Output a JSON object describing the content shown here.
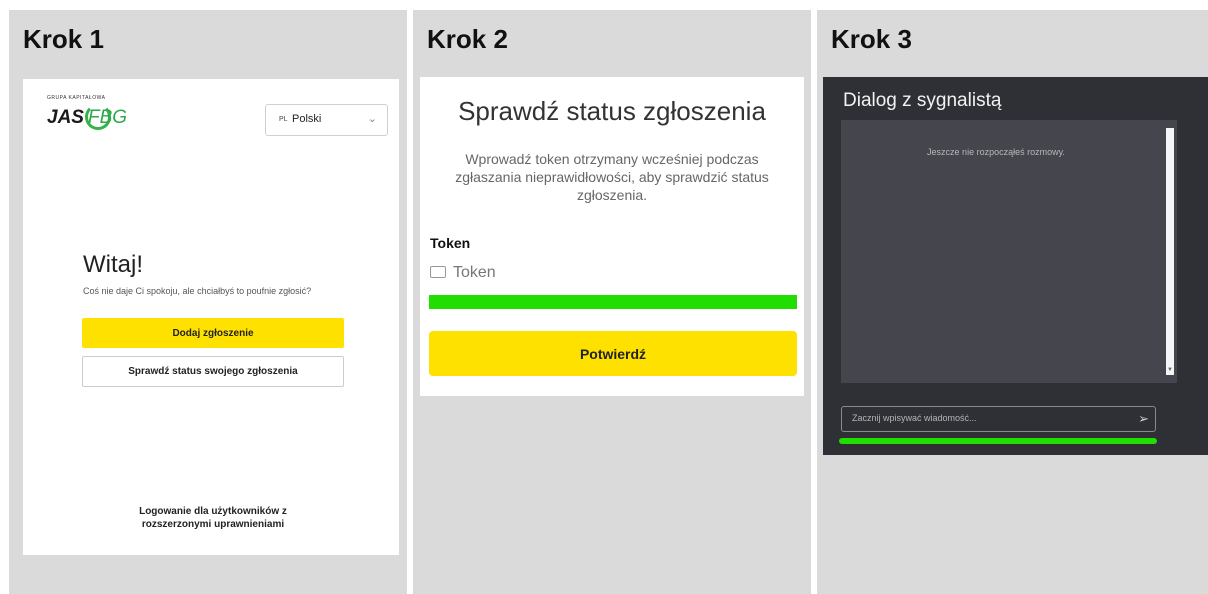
{
  "steps": [
    {
      "label": "Krok 1"
    },
    {
      "label": "Krok 2"
    },
    {
      "label": "Krok 3"
    }
  ],
  "step1": {
    "logo_group": "GRUPA KAPITAŁOWA",
    "logo_jas": "JAS",
    "logo_fbg": "FBG",
    "lang_code": "PL",
    "lang_name": "Polski",
    "welcome": "Witaj!",
    "subtitle": "Coś nie daje Ci spokoju, ale chciałbyś to poufnie zgłosić?",
    "add_button": "Dodaj zgłoszenie",
    "status_button": "Sprawdź status swojego zgłoszenia",
    "login_link": "Logowanie dla użytkowników z rozszerzonymi uprawnieniami"
  },
  "step2": {
    "title": "Sprawdź status zgłoszenia",
    "description": "Wprowadź token otrzymany wcześniej podczas zgłaszania nieprawidłowości, aby sprawdzić status zgłoszenia.",
    "token_label": "Token",
    "token_placeholder": "Token",
    "confirm_button": "Potwierdź"
  },
  "step3": {
    "title": "Dialog z sygnalistą",
    "empty_message": "Jeszcze nie rozpocząłeś rozmowy.",
    "message_placeholder": "Zacznij wpisywać wiadomość..."
  },
  "colors": {
    "accent_yellow": "#ffe100",
    "highlight_green": "#22dd00",
    "dark_panel": "#2f3036"
  },
  "icons": [
    "chevron-down-icon",
    "ticket-icon",
    "send-icon"
  ]
}
